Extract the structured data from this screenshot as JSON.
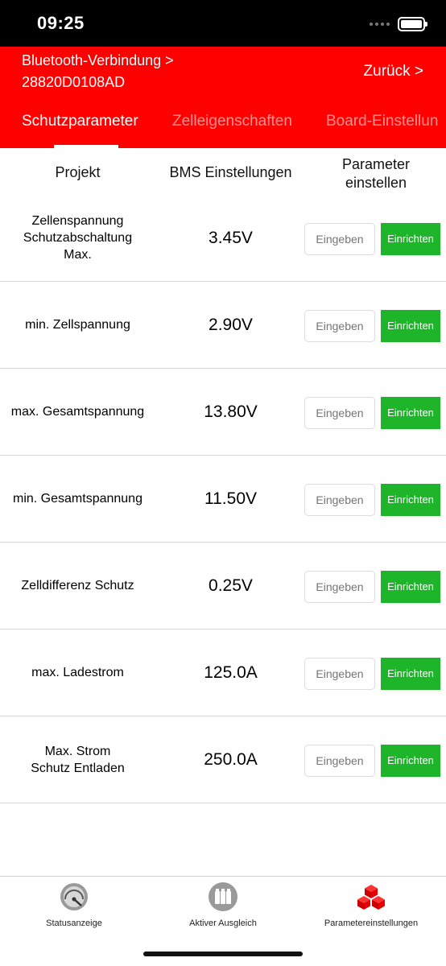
{
  "status_bar": {
    "time": "09:25"
  },
  "header": {
    "connection_line1": "Bluetooth-Verbindung >",
    "connection_line2": "28820D0108AD",
    "back_label": "Zurück >",
    "tabs": [
      {
        "label": "Schutzparameter",
        "active": true
      },
      {
        "label": "Zelleigenschaften",
        "active": false
      },
      {
        "label": "Board-Einstellun",
        "active": false
      }
    ]
  },
  "table": {
    "columns": [
      "Projekt",
      "BMS Einstellungen",
      "Parameter\neinstellen"
    ],
    "input_placeholder": "Eingeben",
    "button_label": "Einrichten",
    "rows": [
      {
        "project": "Zellenspannung\nSchutzabschaltung\nMax.",
        "value": "3.45V"
      },
      {
        "project": "min. Zellspannung",
        "value": "2.90V"
      },
      {
        "project": "max. Gesamtspannung",
        "value": "13.80V"
      },
      {
        "project": "min. Gesamtspannung",
        "value": "11.50V"
      },
      {
        "project": "Zelldifferenz Schutz",
        "value": "0.25V"
      },
      {
        "project": "max. Ladestrom",
        "value": "125.0A"
      },
      {
        "project": "Max. Strom\nSchutz Entladen",
        "value": "250.0A"
      }
    ]
  },
  "tabbar": {
    "items": [
      {
        "label": "Statusanzeige",
        "icon": "gauge-icon"
      },
      {
        "label": "Aktiver Ausgleich",
        "icon": "battery-cells-icon"
      },
      {
        "label": "Parametereinstellungen",
        "icon": "hexagon-cubes-icon"
      }
    ]
  },
  "colors": {
    "header_red": "#ff0000",
    "button_green": "#1fb52a"
  }
}
